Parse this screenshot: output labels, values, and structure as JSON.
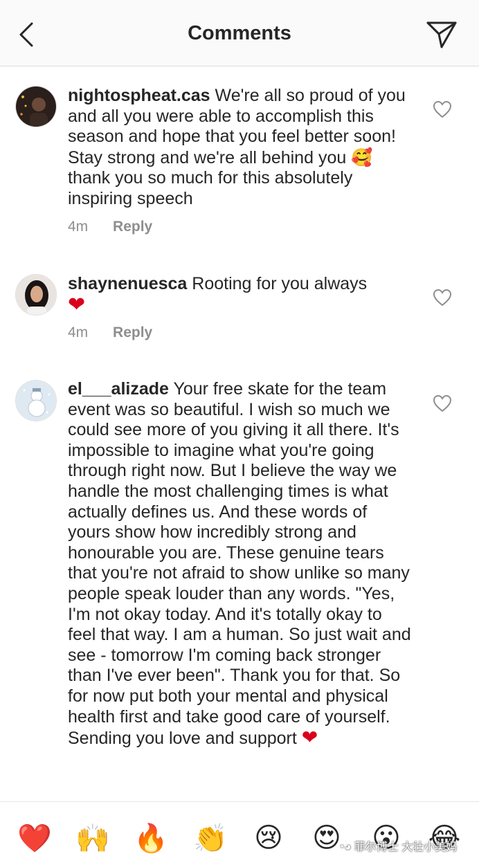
{
  "header": {
    "title": "Comments"
  },
  "comments": [
    {
      "username": "nightospheat.cas",
      "text": "We're all so proud of you and all you were able to accomplish this season and hope that you feel better soon! Stay strong and we're all behind you",
      "emoji": "🥰",
      "text_after": "thank you so much for this absolutely inspiring speech",
      "time": "4m",
      "reply": "Reply"
    },
    {
      "username": "shaynenuesca",
      "text": "Rooting for you always",
      "emoji": "❤",
      "time": "4m",
      "reply": "Reply"
    },
    {
      "username": "el___alizade",
      "text": "Your free skate for the team event was so beautiful. I wish so much we could see more of you giving it all there. It's impossible to imagine what you're going through right now. But I believe the way we handle the most challenging times is what actually defines us. And these words of yours show how incredibly strong and honourable you are. These genuine tears that you're not afraid to show unlike so many people speak louder than any words. \"Yes, I'm not okay today. And it's totally okay to feel that way. I am a human. So just wait and see - tomorrow I'm coming back stronger than I've ever been\". Thank you for that. So for now put both your mental and physical health first and take good care of yourself. Sending you love and support",
      "emoji": "❤"
    }
  ],
  "reactions": [
    "❤️",
    "🙌",
    "🔥",
    "👏",
    "😢",
    "😍",
    "😮",
    "😂"
  ],
  "watermark": "菲尔博士 大壮小美妈",
  "colors": {
    "text": "#262626",
    "muted": "#8e8e8e",
    "heart": "#d9001b"
  }
}
